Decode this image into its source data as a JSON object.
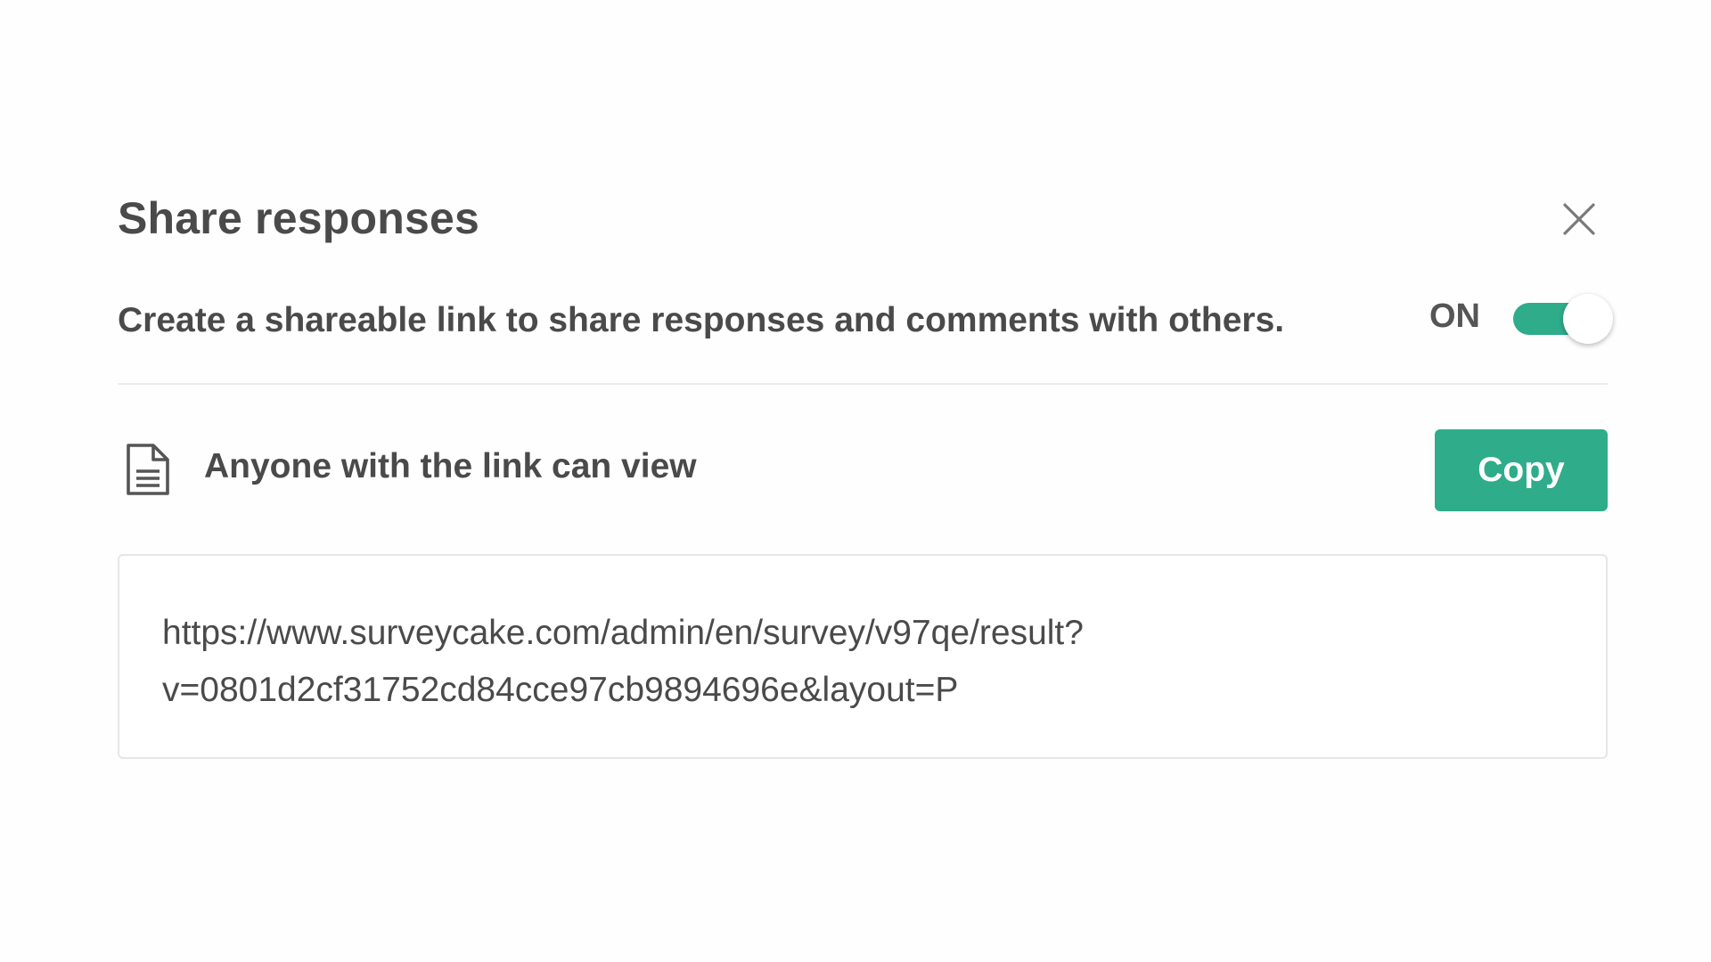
{
  "dialog": {
    "title": "Share responses",
    "close_icon": "close-icon",
    "toggle": {
      "description": "Create a shareable link to share responses and comments with others.",
      "status_label": "ON",
      "state": true,
      "accent_color": "#2fac8a"
    },
    "link": {
      "icon": "document-icon",
      "access_label": "Anyone with the link can view",
      "copy_label": "Copy",
      "url_line_1": "https://www.surveycake.com/admin/en/survey/v97qe/result?",
      "url_line_2": "v=0801d2cf31752cd84cce97cb9894696e&layout=P"
    }
  }
}
